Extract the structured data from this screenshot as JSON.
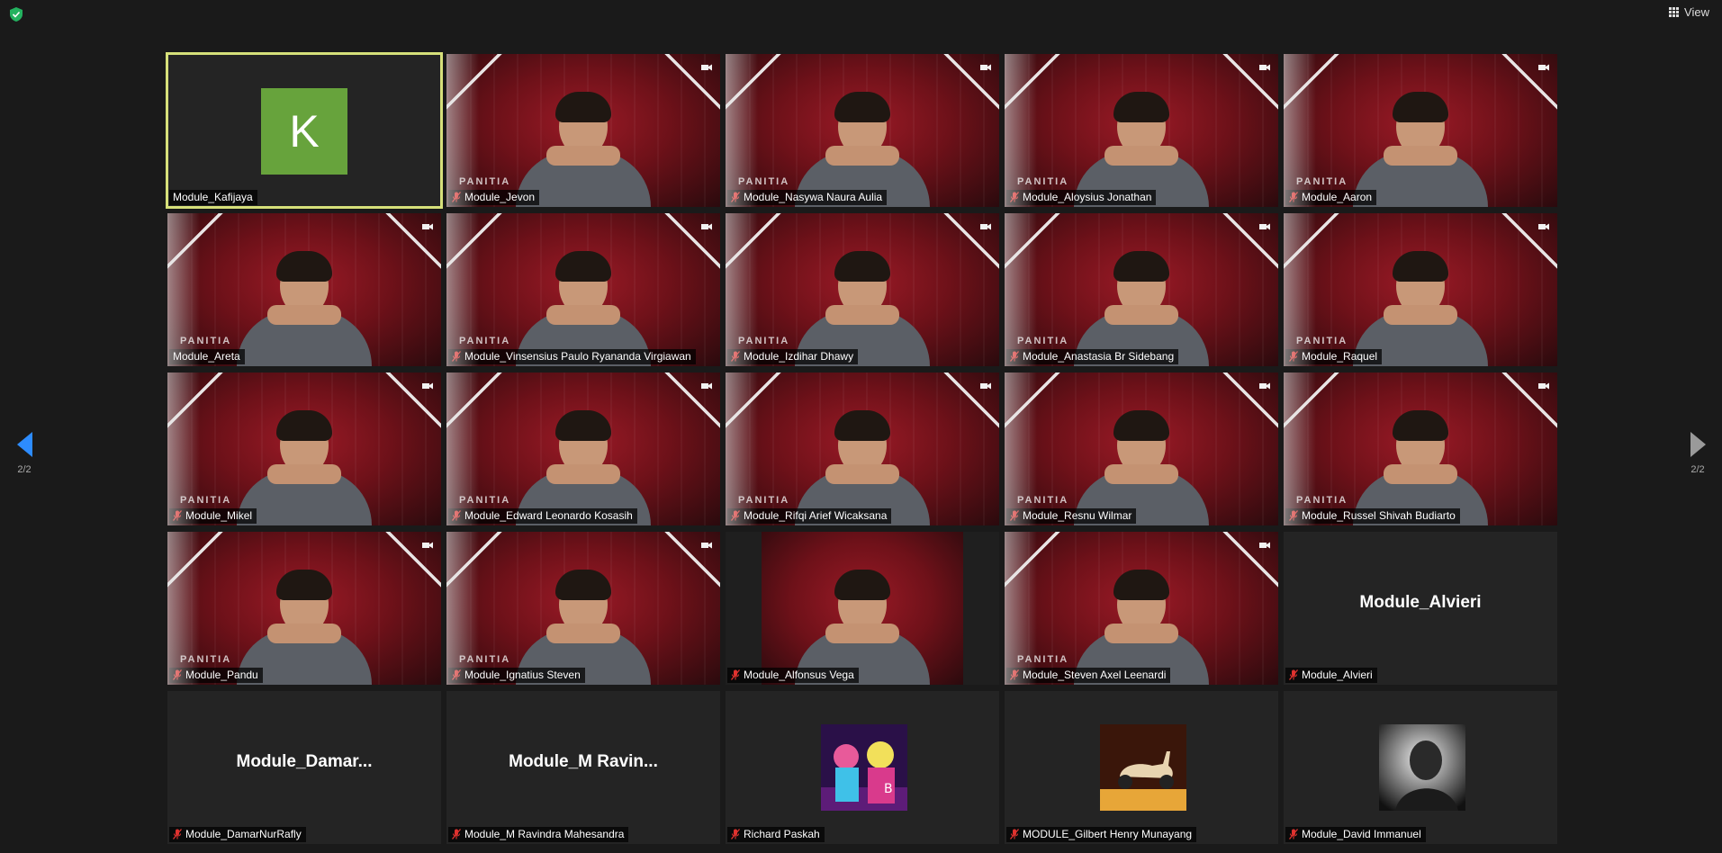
{
  "header": {
    "view_label": "View"
  },
  "pager": {
    "left": "2/2",
    "right": "2/2"
  },
  "tiles": [
    {
      "name": "Module_Kafijaya",
      "type": "avatar",
      "initial": "K",
      "muted": false,
      "active": true
    },
    {
      "name": "Module_Jevon",
      "type": "video",
      "muted": true
    },
    {
      "name": "Module_Nasywa Naura Aulia",
      "type": "video",
      "muted": true
    },
    {
      "name": "Module_Aloysius Jonathan",
      "type": "video",
      "muted": true
    },
    {
      "name": "Module_Aaron",
      "type": "video",
      "muted": true
    },
    {
      "name": "Module_Areta",
      "type": "video",
      "muted": false
    },
    {
      "name": "Module_Vinsensius Paulo Ryananda Virgiawan",
      "type": "video",
      "muted": true
    },
    {
      "name": "Module_Izdihar Dhawy",
      "type": "video",
      "muted": true
    },
    {
      "name": "Module_Anastasia Br Sidebang",
      "type": "video",
      "muted": true
    },
    {
      "name": "Module_Raquel",
      "type": "video",
      "muted": true
    },
    {
      "name": "Module_Mikel",
      "type": "video",
      "muted": true
    },
    {
      "name": "Module_Edward Leonardo Kosasih",
      "type": "video",
      "muted": true
    },
    {
      "name": "Module_Rifqi Arief Wicaksana",
      "type": "video",
      "muted": true
    },
    {
      "name": "Module_Resnu Wilmar",
      "type": "video",
      "muted": true
    },
    {
      "name": "Module_Russel Shivah Budiarto",
      "type": "video",
      "muted": true
    },
    {
      "name": "Module_Pandu",
      "type": "video",
      "muted": true
    },
    {
      "name": "Module_Ignatius Steven",
      "type": "video",
      "muted": true
    },
    {
      "name": "Module_Alfonsus Vega",
      "type": "video-narrow",
      "muted": true
    },
    {
      "name": "Module_Steven Axel Leenardi",
      "type": "video",
      "muted": true
    },
    {
      "name": "Module_Alvieri",
      "type": "name-only",
      "display_name": "Module_Alvieri",
      "muted": true
    },
    {
      "name": "Module_DamarNurRafly",
      "type": "name-only",
      "display_name": "Module_Damar...",
      "muted": true
    },
    {
      "name": "Module_M Ravindra Mahesandra",
      "type": "name-only",
      "display_name": "Module_M  Ravin...",
      "muted": true
    },
    {
      "name": "Richard Paskah",
      "type": "picture",
      "picture": "cartoon-characters",
      "muted": true
    },
    {
      "name": "MODULE_Gilbert Henry Munayang",
      "type": "picture",
      "picture": "scooter",
      "muted": true
    },
    {
      "name": "Module_David Immanuel",
      "type": "picture",
      "picture": "grayscale-photo",
      "muted": true
    }
  ],
  "overlay_text": "PANITIA",
  "colors": {
    "active_border": "#d6e07a",
    "avatar_bg": "#67a33c",
    "muted_mic": "#e0322f",
    "pager_arrow": "#2d8cff"
  }
}
